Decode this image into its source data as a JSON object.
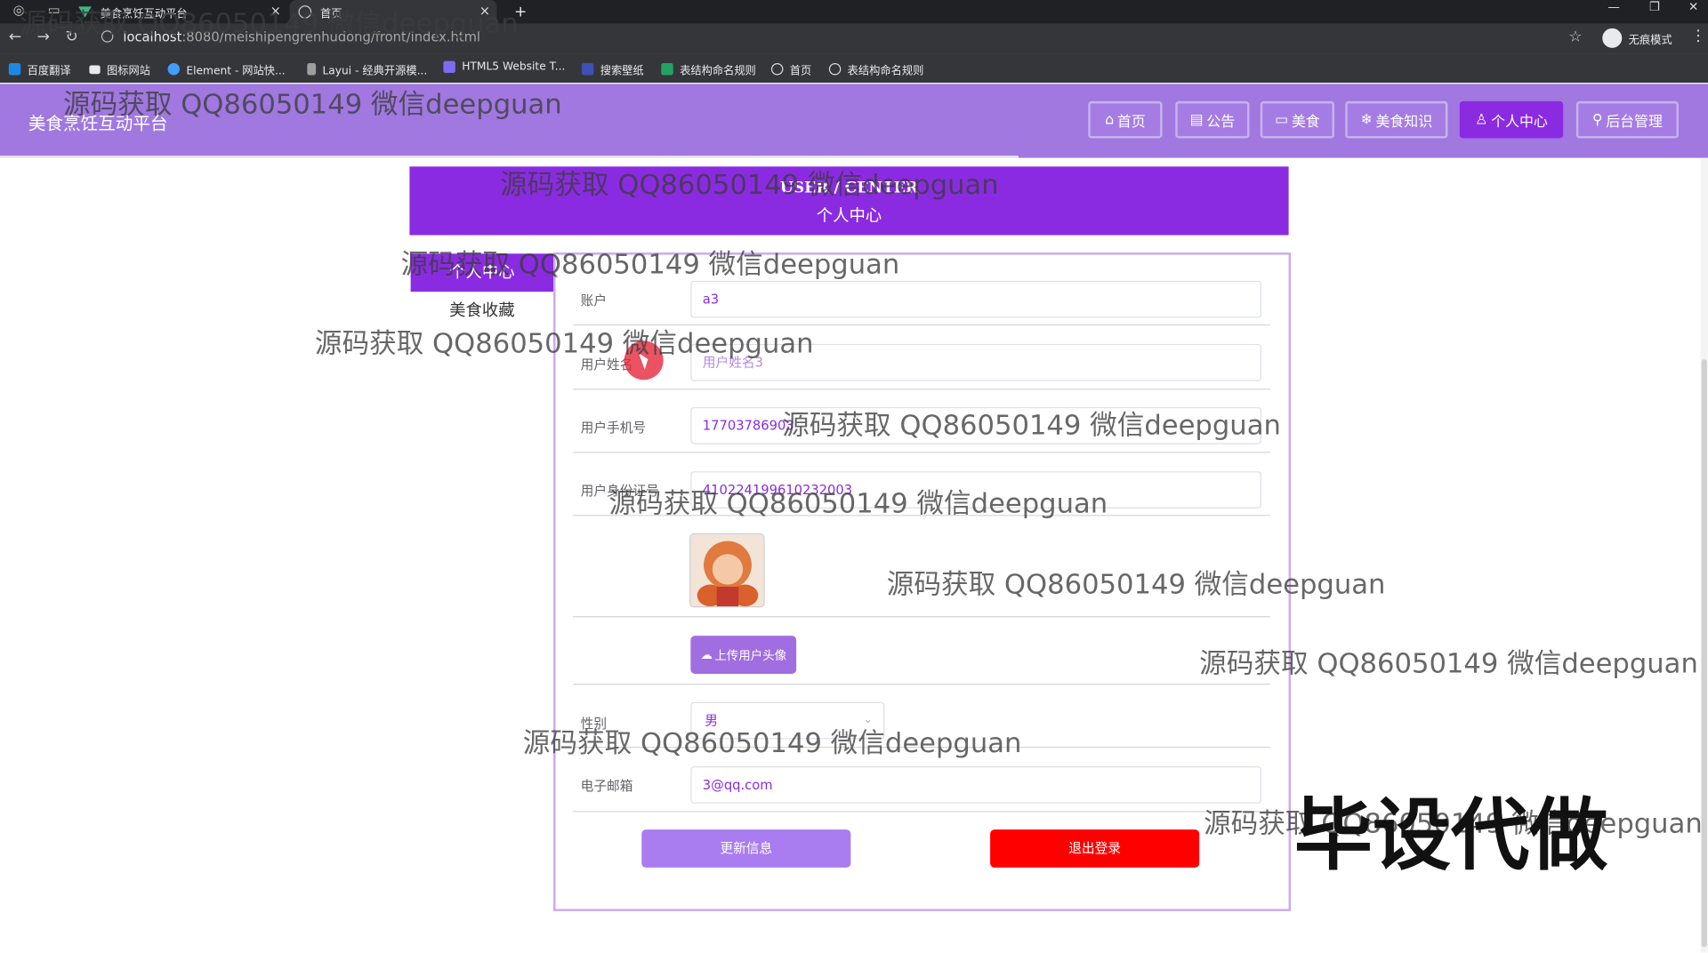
{
  "browser": {
    "tabs": [
      {
        "title": "美食烹饪互动平台"
      },
      {
        "title": "首页"
      }
    ],
    "new_tab": "+",
    "url_host": "localhost",
    "url_path": ":8080/meishipengrenhudong/front/index.html",
    "incognito_label": "无痕模式",
    "bookmarks": [
      "百度翻译",
      "图标网站",
      "Element - 网站快...",
      "Layui - 经典开源模...",
      "HTML5 Website T...",
      "搜索壁纸",
      "表结构命名规则",
      "首页",
      "表结构命名规则"
    ]
  },
  "site": {
    "brand": "美食烹饪互动平台",
    "nav": [
      {
        "label": "首页",
        "icon": "home-icon",
        "active": false
      },
      {
        "label": "公告",
        "icon": "notice-icon",
        "active": false
      },
      {
        "label": "美食",
        "icon": "food-icon",
        "active": false
      },
      {
        "label": "美食知识",
        "icon": "knowledge-icon",
        "active": false
      },
      {
        "label": "个人中心",
        "icon": "user-icon",
        "active": true
      },
      {
        "label": "后台管理",
        "icon": "link-icon",
        "active": false
      }
    ]
  },
  "banner": {
    "en": "USER / CENTER",
    "zh": "个人中心"
  },
  "sidebar": {
    "items": [
      {
        "label": "个人中心",
        "active": true
      },
      {
        "label": "美食收藏",
        "active": false
      }
    ]
  },
  "form": {
    "account": {
      "label": "账户",
      "value": "a3"
    },
    "name": {
      "label": "用户姓名",
      "placeholder": "用户姓名3"
    },
    "phone": {
      "label": "用户手机号",
      "value": "17703786903"
    },
    "idcard": {
      "label": "用户身份证号",
      "value": "410224199610232003"
    },
    "avatar_alt": "用户头像",
    "upload_label": "上传用户头像",
    "gender": {
      "label": "性别",
      "value": "男"
    },
    "email": {
      "label": "电子邮箱",
      "value": "3@qq.com"
    },
    "update_label": "更新信息",
    "logout_label": "退出登录"
  },
  "watermark": {
    "text": "源码获取 QQ86050149 微信deepguan",
    "badge": "毕设代做"
  },
  "colors": {
    "header": "#a078e0",
    "accent": "#8a2be2",
    "logout": "#ff0000"
  }
}
